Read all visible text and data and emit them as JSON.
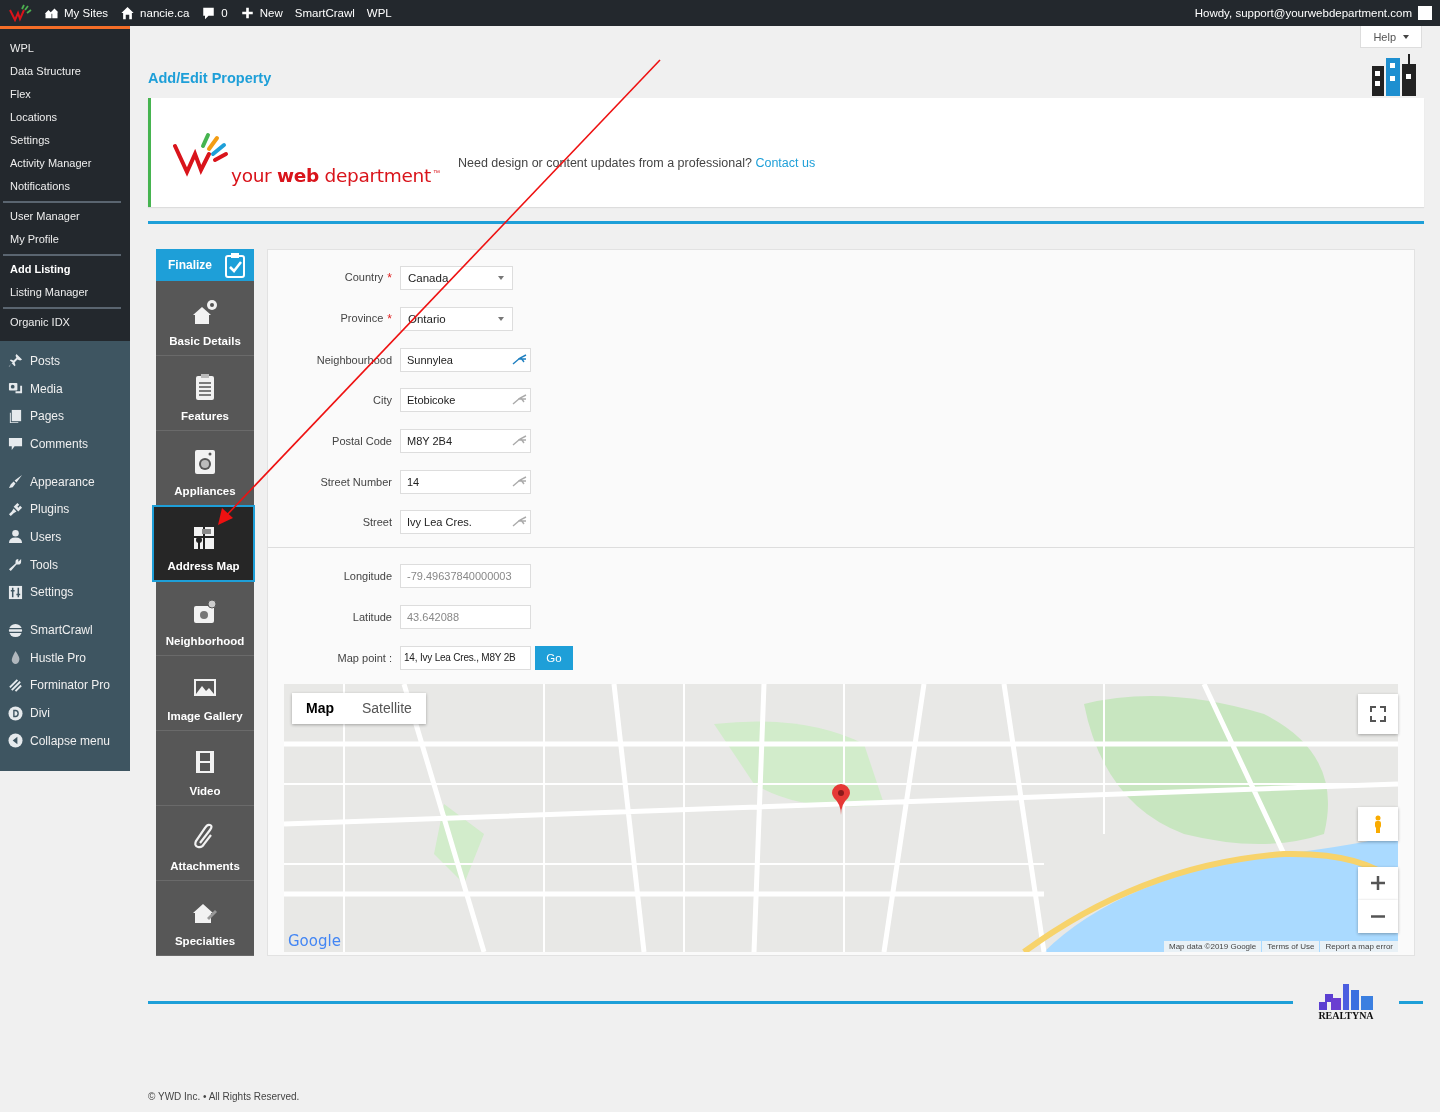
{
  "admin_bar": {
    "items": [
      {
        "kind": "sites",
        "label": "My Sites"
      },
      {
        "kind": "home",
        "label": "nancie.ca"
      },
      {
        "kind": "comments",
        "label": "0"
      },
      {
        "kind": "new",
        "label": "New"
      },
      {
        "kind": "plain",
        "label": "SmartCrawl"
      },
      {
        "kind": "plain",
        "label": "WPL"
      }
    ],
    "greeting": "Howdy, support@yourwebdepartment.com"
  },
  "sidebar": {
    "submenu": [
      [
        {
          "label": "WPL",
          "selected": false
        },
        {
          "label": "Data Structure",
          "selected": false
        },
        {
          "label": "Flex",
          "selected": false
        },
        {
          "label": "Locations",
          "selected": false
        },
        {
          "label": "Settings",
          "selected": false
        },
        {
          "label": "Activity Manager",
          "selected": false
        },
        {
          "label": "Notifications",
          "selected": false
        }
      ],
      [
        {
          "label": "User Manager",
          "selected": false
        },
        {
          "label": "My Profile",
          "selected": false
        }
      ],
      [
        {
          "label": "Add Listing",
          "selected": true
        },
        {
          "label": "Listing Manager",
          "selected": false
        }
      ],
      [
        {
          "label": "Organic IDX",
          "selected": false
        }
      ]
    ],
    "menu": [
      [
        {
          "kind": "pin",
          "label": "Posts"
        },
        {
          "kind": "media",
          "label": "Media"
        },
        {
          "kind": "pages",
          "label": "Pages"
        },
        {
          "kind": "comments",
          "label": "Comments"
        }
      ],
      [
        {
          "kind": "brush",
          "label": "Appearance"
        },
        {
          "kind": "plug",
          "label": "Plugins"
        },
        {
          "kind": "user",
          "label": "Users"
        },
        {
          "kind": "wrench",
          "label": "Tools"
        },
        {
          "kind": "sliders",
          "label": "Settings"
        }
      ],
      [
        {
          "kind": "stripes",
          "label": "SmartCrawl"
        },
        {
          "kind": "drop",
          "label": "Hustle Pro"
        },
        {
          "kind": "slashes",
          "label": "Forminator Pro"
        },
        {
          "kind": "letter",
          "label": "Divi"
        },
        {
          "kind": "collapse",
          "label": "Collapse menu"
        }
      ]
    ]
  },
  "help": "Help",
  "title": "Add/Edit Property",
  "banner": {
    "logo": "your **web** department",
    "trademark": "™",
    "message": "Need design or content updates from a professional?",
    "link": "Contact us"
  },
  "tabs": {
    "finalize": "Finalize",
    "items": [
      {
        "kind": "house-gear",
        "label": "Basic Details",
        "selected": false
      },
      {
        "kind": "clipboard",
        "label": "Features",
        "selected": false
      },
      {
        "kind": "washer",
        "label": "Appliances",
        "selected": false
      },
      {
        "kind": "map",
        "label": "Address Map",
        "selected": true
      },
      {
        "kind": "pin-photo",
        "label": "Neighborhood",
        "selected": false
      },
      {
        "kind": "picture",
        "label": "Image Gallery",
        "selected": false
      },
      {
        "kind": "film",
        "label": "Video",
        "selected": false
      },
      {
        "kind": "clip",
        "label": "Attachments",
        "selected": false
      },
      {
        "kind": "house-wrench",
        "label": "Specialties",
        "selected": false
      }
    ]
  },
  "form": {
    "required_mark": "*",
    "address_fields": [
      {
        "kind": "select",
        "label": "Country",
        "required": true,
        "value": "Canada"
      },
      {
        "kind": "select",
        "label": "Province",
        "required": true,
        "value": "Ontario"
      },
      {
        "kind": "suggest",
        "label": "Neighbourhood",
        "required": false,
        "value": "Sunnylea",
        "active": true
      },
      {
        "kind": "suggest",
        "label": "City",
        "required": false,
        "value": "Etobicoke",
        "active": false
      },
      {
        "kind": "suggest",
        "label": "Postal Code",
        "required": false,
        "value": "M8Y 2B4",
        "active": false
      },
      {
        "kind": "suggest",
        "label": "Street Number",
        "required": false,
        "value": "14",
        "active": false
      },
      {
        "kind": "suggest",
        "label": "Street",
        "required": false,
        "value": "Ivy Lea Cres.",
        "active": false
      }
    ],
    "coordinate_fields": [
      {
        "label": "Longitude",
        "value": "-79.49637840000003",
        "readonly": true
      },
      {
        "label": "Latitude",
        "value": "43.642088",
        "readonly": true
      }
    ],
    "map_point": {
      "label": "Map point :",
      "value": "14, Ivy Lea Cres., M8Y 2B",
      "button": "Go"
    }
  },
  "map": {
    "buttons": [
      {
        "label": "Map",
        "selected": true
      },
      {
        "label": "Satellite",
        "selected": false
      }
    ],
    "brand": "Google",
    "attributions": [
      "Map data ©2019 Google",
      "Terms of Use",
      "Report a map error"
    ]
  },
  "footer": {
    "realtyna": "REALTYNA",
    "copyright": "© YWD Inc. • All Rights Reserved."
  }
}
